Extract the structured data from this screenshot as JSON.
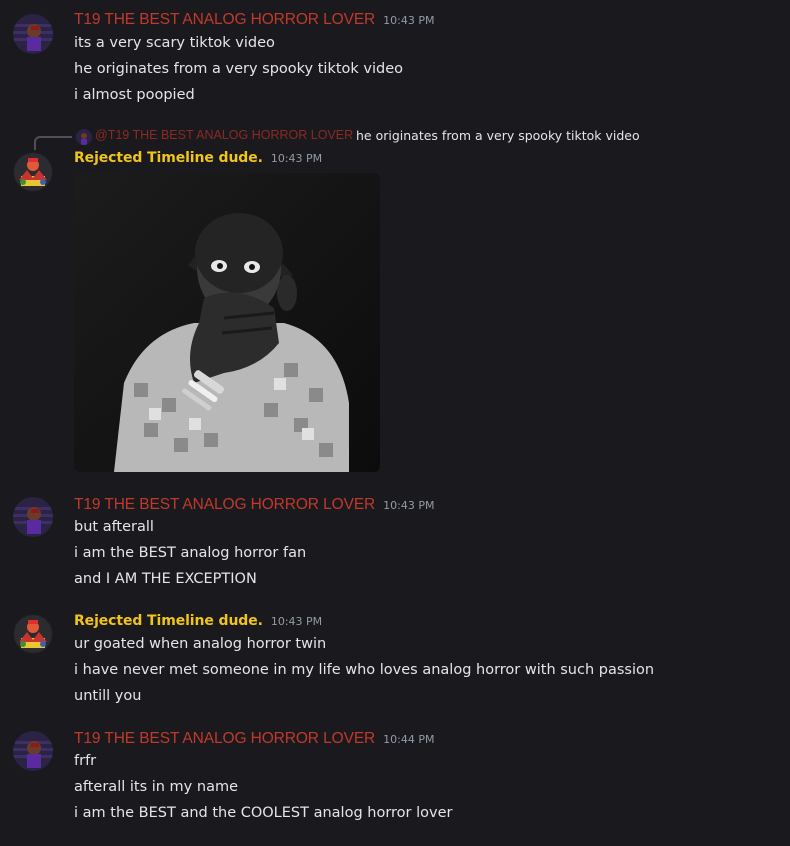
{
  "users": {
    "t19": {
      "name": "T19 THE BEST ANALOG HORROR LOVER",
      "color": "#c0392b"
    },
    "rejected": {
      "name": "Rejected Timeline dude.",
      "color": "#f0c419"
    }
  },
  "messages": [
    {
      "user": "T19 THE BEST ANALOG HORROR LOVER",
      "time": "10:43 PM",
      "lines": [
        "its a very scary tiktok video",
        "he originates from a very spooky tiktok video",
        "i almost poopied"
      ]
    },
    {
      "user": "Rejected Timeline dude.",
      "time": "10:43 PM",
      "reply": {
        "mention": "@T19 THE BEST ANALOG HORROR LOVER",
        "text": "he originates from a very spooky tiktok video"
      },
      "attachment": "image-attachment"
    },
    {
      "user": "T19 THE BEST ANALOG HORROR LOVER",
      "time": "10:43 PM",
      "lines": [
        "but afterall",
        "i am the BEST analog horror fan",
        "and I AM THE EXCEPTION"
      ]
    },
    {
      "user": "Rejected Timeline dude.",
      "time": "10:43 PM",
      "lines": [
        "ur goated when analog horror twin",
        "i have never met someone in my life who loves analog horror with such passion",
        "untill you"
      ]
    },
    {
      "user": "T19 THE BEST ANALOG HORROR LOVER",
      "time": "10:44 PM",
      "lines": [
        "frfr",
        "afterall its in my name",
        "i am the BEST and the COOLEST analog horror lover"
      ]
    }
  ]
}
